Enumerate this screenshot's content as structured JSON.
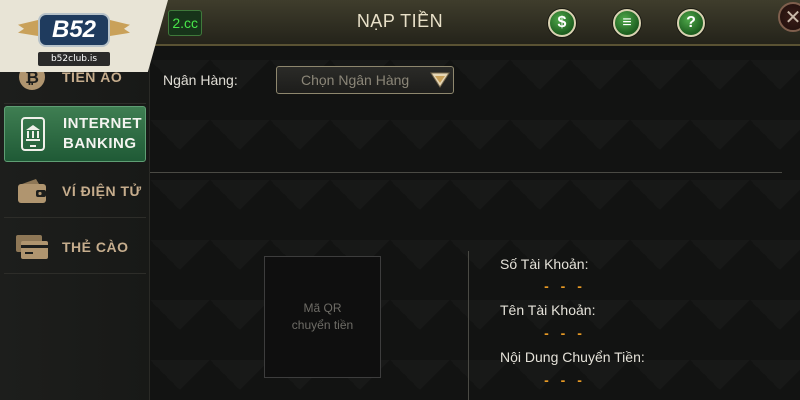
{
  "header": {
    "url_fragment": "2.cc",
    "title": "NẠP TIỀN",
    "icons": [
      {
        "name": "coin-icon",
        "glyph": "$"
      },
      {
        "name": "list-icon",
        "glyph": "≡"
      },
      {
        "name": "help-icon",
        "glyph": "?"
      }
    ],
    "close_glyph": "✕"
  },
  "logo": {
    "mark": "B52",
    "site": "b52club.is"
  },
  "sidebar": {
    "items": [
      {
        "id": "tien-ao",
        "label": "TIỀN ẢO",
        "icon": "bitcoin-icon",
        "active": false
      },
      {
        "id": "internet-banking",
        "label": "INTERNET\nBANKING",
        "icon": "bank-phone-icon",
        "active": true
      },
      {
        "id": "vi-dien-tu",
        "label": "VÍ ĐIỆN TỬ",
        "icon": "wallet-icon",
        "active": false
      },
      {
        "id": "the-cao",
        "label": "THẺ CÀO",
        "icon": "card-icon",
        "active": false
      }
    ]
  },
  "form": {
    "bank_label": "Ngân Hàng:",
    "bank_placeholder": "Chọn Ngân Hàng"
  },
  "qr": {
    "line1": "Mã QR",
    "line2": "chuyển tiền"
  },
  "details": {
    "account_number_label": "Số Tài Khoản:",
    "account_number_value": "- - -",
    "account_name_label": "Tên Tài Khoản:",
    "account_name_value": "- - -",
    "transfer_content_label": "Nội Dung Chuyển Tiền:",
    "transfer_content_value": "- - -"
  },
  "colors": {
    "accent_green": "#1f5a36",
    "value_orange": "#e89a24",
    "sidebar_text": "#c6ad8d"
  }
}
